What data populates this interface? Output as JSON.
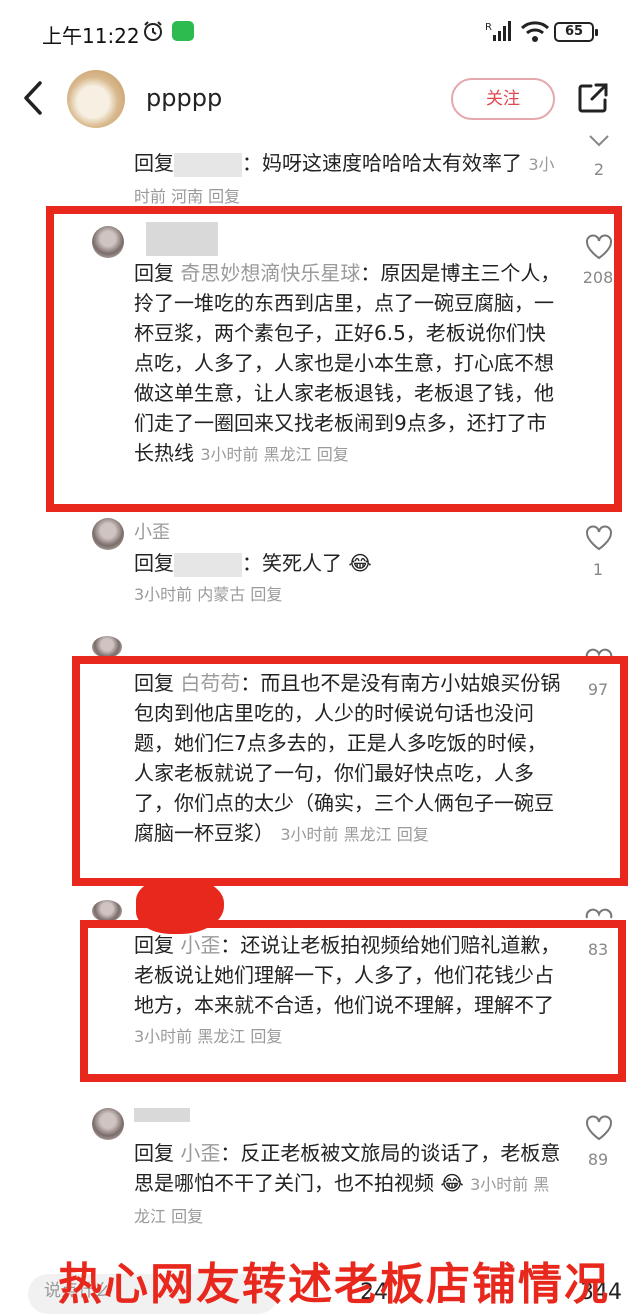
{
  "status": {
    "time": "上午11:22",
    "battery": "65"
  },
  "header": {
    "name": "ppppp",
    "follow": "关注"
  },
  "comments": [
    {
      "reply": "回复",
      "text": "：妈呀这速度哈哈哈太有效率了",
      "meta": "3小时前 河南 回复",
      "likes": "2"
    },
    {
      "reply": "回复",
      "target": "奇思妙想滴快乐星球",
      "text": "：原因是博主三个人，拎了一堆吃的东西到店里，点了一碗豆腐脑，一杯豆浆，两个素包子，正好6.5，老板说你们快点吃，人多了，人家也是小本生意，打心底不想做这单生意，让人家老板退钱，老板退了钱，他们走了一圈回来又找老板闹到9点多，还打了市长热线",
      "meta": "3小时前 黑龙江 回复",
      "likes": "208"
    },
    {
      "user": "小歪",
      "reply": "回复",
      "text": "：笑死人了",
      "meta": "3小时前 内蒙古 回复",
      "likes": "1"
    },
    {
      "reply": "回复",
      "target": "白苟苟",
      "text": "：而且也不是没有南方小姑娘买份锅包肉到他店里吃的，人少的时候说句话也没问题，她们仨7点多去的，正是人多吃饭的时候，人家老板就说了一句，你们最好快点吃，人多了，你们点的太少（确实，三个人俩包子一碗豆腐脑一杯豆浆）",
      "meta": "3小时前 黑龙江 回复",
      "likes": "97"
    },
    {
      "reply": "回复",
      "target": "小歪",
      "text": "：还说让老板拍视频给她们赔礼道歉，老板说让她们理解一下，人多了，他们花钱少占地方，本来就不合适，他们说不理解，理解不了",
      "meta": "3小时前 黑龙江 回复",
      "likes": "83"
    },
    {
      "reply": "回复",
      "target": "小歪",
      "text": "：反正老板被文旅局的谈话了，老板意思是哪怕不干了关门，也不拍视频",
      "meta": "3小时前 黑龙江 回复",
      "likes": "89"
    }
  ],
  "bottom": {
    "input_placeholder": "说点什么",
    "caption": "热心网友转述老板店铺情况",
    "count1": "24",
    "count2": "344"
  }
}
